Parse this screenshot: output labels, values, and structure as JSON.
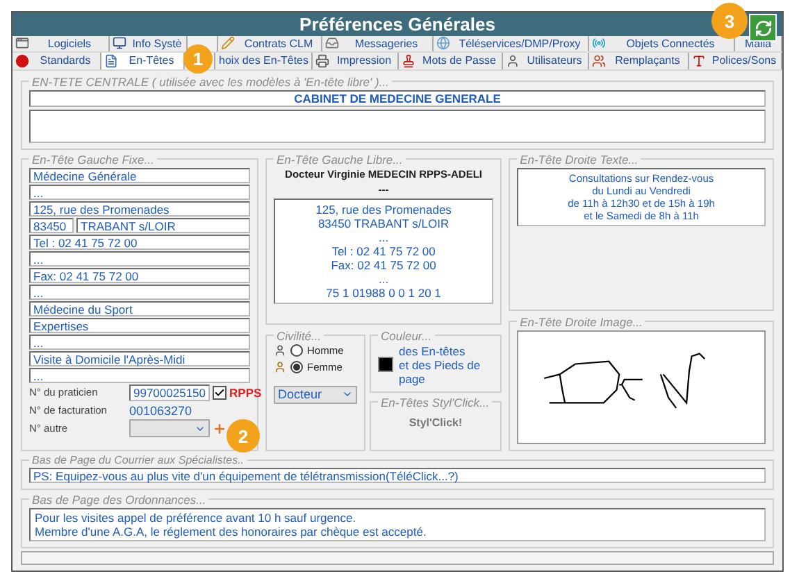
{
  "window": {
    "title": "Préférences Générales"
  },
  "tabs_row_1": [
    {
      "label": "Logiciels",
      "selected": false
    },
    {
      "label": "Info Systè",
      "selected": false
    },
    {
      "label": "Contrats CLM",
      "selected": false
    },
    {
      "label": "Messageries",
      "selected": false
    },
    {
      "label": "Téléservices/DMP/Proxy",
      "selected": false
    },
    {
      "label": "Objets Connectés",
      "selected": false
    },
    {
      "label": "Maiia",
      "selected": false
    }
  ],
  "tabs_row_2": [
    {
      "label": "Standards",
      "selected": false
    },
    {
      "label": "En-Têtes",
      "selected": true
    },
    {
      "label": "hoix des En-Têtes",
      "selected": false
    },
    {
      "label": "Impression",
      "selected": false
    },
    {
      "label": "Mots de Passe",
      "selected": false
    },
    {
      "label": "Utilisateurs",
      "selected": false
    },
    {
      "label": "Remplaçants",
      "selected": false
    },
    {
      "label": "Polices/Sons",
      "selected": false
    }
  ],
  "callouts": [
    "1",
    "2",
    "3"
  ],
  "central_header": {
    "legend": "EN-TETE CENTRALE  ( utilisée avec les modèles à 'En-tête libre' )...",
    "title": "CABINET DE MEDECINE GENERALE"
  },
  "left_fixed": {
    "legend": "En-Tête Gauche Fixe...",
    "lines": [
      [
        "Médecine Générale"
      ],
      [
        "..."
      ],
      [
        "125, rue des Promenades"
      ],
      [
        "83450",
        "TRABANT s/LOIR"
      ],
      [
        "Tel : 02 41 75 72 00"
      ],
      [
        "..."
      ],
      [
        "Fax: 02 41 75 72 00"
      ],
      [
        "..."
      ],
      [
        "Médecine du Sport"
      ],
      [
        "Expertises"
      ],
      [
        "..."
      ],
      [
        "Visite à Domicile l'Après-Midi"
      ],
      [
        "..."
      ]
    ],
    "ids": [
      {
        "kind": "input",
        "label": "N° du praticien",
        "value": "99700025150",
        "check_label": "RPPS",
        "checked": true
      },
      {
        "kind": "text",
        "label": "N° de facturation",
        "value": "001063270"
      },
      {
        "kind": "select",
        "label": "N° autre"
      }
    ]
  },
  "left_free": {
    "legend": "En-Tête Gauche Libre...",
    "heading": "Docteur  Virginie MEDECIN RPPS-ADELI",
    "separator": "---",
    "lines": [
      "125, rue des Promenades",
      "83450  TRABANT s/LOIR",
      "...",
      "Tel : 02 41 75 72 00",
      "Fax: 02 41 75 72 00",
      "...",
      "75 1 01988  0  0 1 20 1"
    ]
  },
  "right_text": {
    "legend": "En-Tête Droite Texte...",
    "lines": [
      "Consultations sur Rendez-vous",
      "du Lundi  au Vendredi",
      "de 11h à 12h30 et de 15h à 19h",
      "et le Samedi de 8h à 11h"
    ]
  },
  "civility": {
    "legend": "Civilité...",
    "options": [
      {
        "label": "Homme",
        "selected": false
      },
      {
        "label": "Femme",
        "selected": true
      }
    ],
    "title_select": "Docteur"
  },
  "color": {
    "legend": "Couleur...",
    "color": "#000000",
    "lines": [
      "des En-têtes",
      "et des Pieds de page"
    ]
  },
  "stylclick": {
    "legend": "En-Têtes Styl'Click...",
    "button": "Styl'Click!"
  },
  "right_image": {
    "legend": "En-Tête Droite Image..."
  },
  "footer_letters": {
    "legend": "Bas de Page du Courrier  aux  Spécialistes..",
    "value": "PS: Equipez-vous au plus vite d'un équipement de télétransmission(TéléClick...?)"
  },
  "footer_prescriptions": {
    "legend": "Bas de Page des Ordonnances...",
    "lines": [
      "Pour les visites appel de préférence avant 10 h sauf urgence.",
      "Membre d'une A.G.A, le réglement des honoraires par chèque est accepté."
    ]
  }
}
